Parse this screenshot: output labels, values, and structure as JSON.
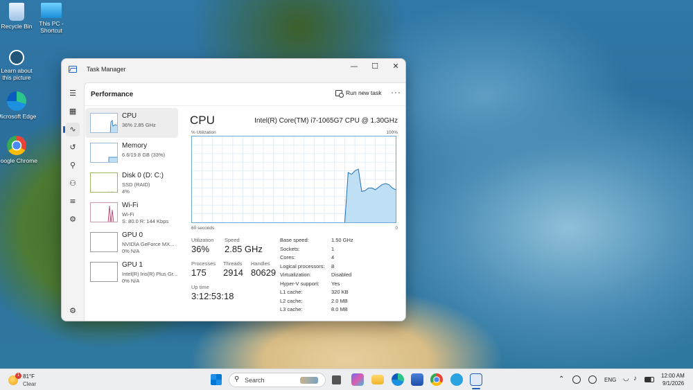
{
  "desktop": {
    "icons": [
      {
        "label": "Recycle Bin",
        "icon": "recycle-bin-icon"
      },
      {
        "label": "This PC - Shortcut",
        "icon": "this-pc-icon"
      },
      {
        "label": "Learn about this picture",
        "icon": "learn-about-picture-icon"
      },
      {
        "label": "Microsoft Edge",
        "icon": "edge-icon"
      },
      {
        "label": "Google Chrome",
        "icon": "chrome-icon"
      }
    ]
  },
  "window": {
    "title": "Task Manager",
    "controls": {
      "minimize": "—",
      "maximize": "☐",
      "close": "✕"
    },
    "page_heading": "Performance",
    "run_new_task": "Run new task",
    "more": "···"
  },
  "nav": [
    "hamburger-icon",
    "processes-icon",
    "performance-icon",
    "app-history-icon",
    "startup-apps-icon",
    "users-icon",
    "details-icon",
    "services-icon",
    "settings-icon"
  ],
  "resources": [
    {
      "name": "CPU",
      "sub1": "36%  2.85 GHz",
      "sub2": ""
    },
    {
      "name": "Memory",
      "sub1": "6.6/19.8 GB (33%)",
      "sub2": ""
    },
    {
      "name": "Disk 0 (D: C:)",
      "sub1": "SSD (RAID)",
      "sub2": "4%"
    },
    {
      "name": "Wi-Fi",
      "sub1": "Wi-Fi",
      "sub2": "S: 80.0  R: 144 Kbps"
    },
    {
      "name": "GPU 0",
      "sub1": "NVIDIA GeForce MX...",
      "sub2": "0%  N/A"
    },
    {
      "name": "GPU 1",
      "sub1": "Intel(R) Iris(R) Plus Gr...",
      "sub2": "0%  N/A"
    }
  ],
  "cpu": {
    "title": "CPU",
    "model": "Intel(R) Core(TM) i7-1065G7 CPU @ 1.30GHz",
    "graph": {
      "y_label": "% Utilization",
      "y_max_label": "100%",
      "x_left_label": "60 seconds",
      "x_right_label": "0",
      "accent": "#1d6fb8",
      "fill": "#bfe0f4",
      "utilization_history": [
        0,
        0,
        0,
        0,
        0,
        0,
        0,
        0,
        0,
        0,
        0,
        0,
        0,
        0,
        0,
        0,
        0,
        0,
        0,
        0,
        0,
        0,
        0,
        0,
        0,
        0,
        0,
        0,
        0,
        0,
        0,
        0,
        0,
        0,
        0,
        0,
        0,
        0,
        0,
        0,
        0,
        0,
        0,
        0,
        0,
        0,
        58,
        56,
        60,
        62,
        36,
        37,
        40,
        40,
        38,
        41,
        44,
        45,
        44,
        40,
        38
      ]
    },
    "stats": {
      "utilization_label": "Utilization",
      "utilization": "36%",
      "speed_label": "Speed",
      "speed": "2.85 GHz",
      "processes_label": "Processes",
      "processes": "175",
      "threads_label": "Threads",
      "threads": "2914",
      "handles_label": "Handles",
      "handles": "80629",
      "uptime_label": "Up time",
      "uptime": "3:12:53:18"
    },
    "specs": [
      {
        "k": "Base speed:",
        "v": "1.50 GHz"
      },
      {
        "k": "Sockets:",
        "v": "1"
      },
      {
        "k": "Cores:",
        "v": "4"
      },
      {
        "k": "Logical processors:",
        "v": "8"
      },
      {
        "k": "Virtualization:",
        "v": "Disabled"
      },
      {
        "k": "Hyper-V support:",
        "v": "Yes"
      },
      {
        "k": "L1 cache:",
        "v": "320 KB"
      },
      {
        "k": "L2 cache:",
        "v": "2.0 MB"
      },
      {
        "k": "L3 cache:",
        "v": "8.0 MB"
      }
    ]
  },
  "taskbar": {
    "weather_temp": "81°F",
    "weather_desc": "Clear",
    "weather_badge": "1",
    "search_placeholder": "Search",
    "language": "ENG",
    "time": "12:00 AM",
    "date": "9/1/2026"
  }
}
